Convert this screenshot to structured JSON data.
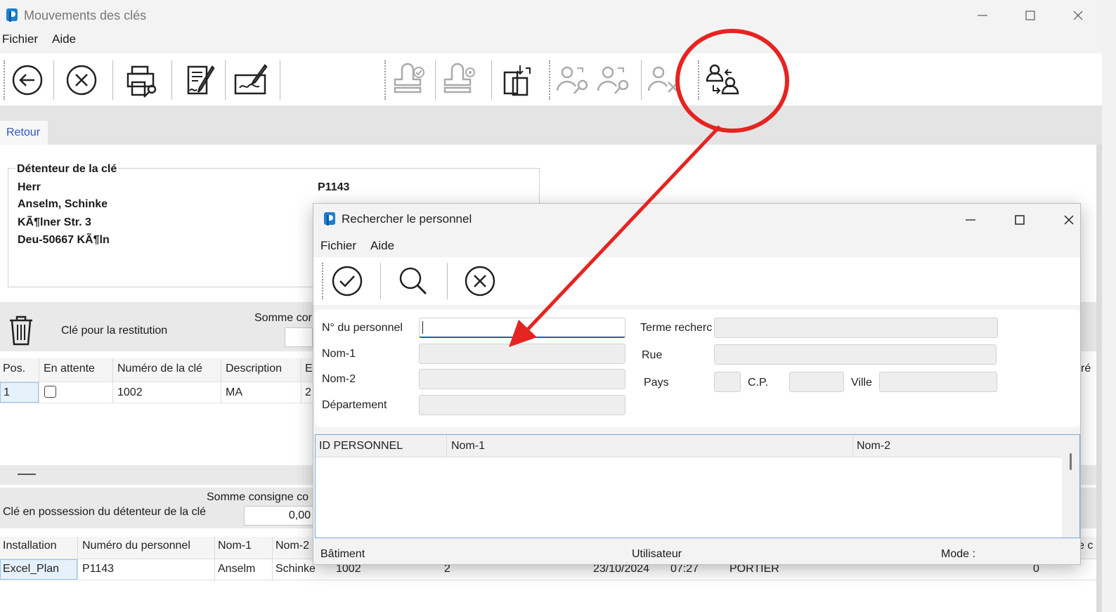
{
  "main": {
    "title": "Mouvements des clés",
    "menu": [
      "Fichier",
      "Aide"
    ],
    "tab_label": "Retour",
    "holder": {
      "legend": "Détenteur de la clé",
      "salutation": "Herr",
      "name": "Anselm, Schinke",
      "street": "KÃ¶lner Str. 3",
      "city": "Deu-50667 KÃ¶ln",
      "personnel_no": "P1143"
    },
    "restitution": {
      "label": "Clé pour la restitution",
      "sum_label": "Somme cor",
      "headers": [
        "Pos.",
        "En attente",
        "Numéro de la clé",
        "Description",
        "E"
      ],
      "row": {
        "pos": "1",
        "key": "1002",
        "desc": "MA",
        "e": "2"
      }
    },
    "possession": {
      "label": "Clé en possession du détenteur de la clé",
      "sum_label": "Somme consigne co",
      "sum_value": "0,00",
      "headers": [
        "Installation",
        "Numéro du personnel",
        "Nom-1",
        "Nom-2"
      ],
      "row": {
        "installation": "Excel_Plan",
        "personnel": "P1143",
        "nom1": "Anselm",
        "nom2": "Schinke",
        "key": "1002",
        "qty": "2",
        "date": "23/10/2024",
        "time": "07:27",
        "user": "PORTIER",
        "zero": "0"
      }
    },
    "right_fragments": {
      "re": "ré",
      "ec": "e c"
    }
  },
  "dialog": {
    "title": "Rechercher le personnel",
    "menu": [
      "Fichier",
      "Aide"
    ],
    "labels": {
      "personnel_no": "N° du personnel",
      "nom1": "Nom-1",
      "nom2": "Nom-2",
      "department": "Département",
      "search_term": "Terme recherc",
      "street": "Rue",
      "country": "Pays",
      "zip": "C.P.",
      "city": "Ville"
    },
    "values": {
      "personnel_no": "",
      "nom1": "",
      "nom2": "",
      "department": "",
      "search_term": "",
      "street": "",
      "country": "",
      "zip": "",
      "city": ""
    },
    "grid_headers": [
      "ID PERSONNEL",
      "Nom-1",
      "Nom-2"
    ],
    "status": {
      "building": "Bâtiment",
      "user": "Utilisateur",
      "mode": "Mode :"
    }
  },
  "colors": {
    "annotation": "#e52421",
    "link": "#2a56c6",
    "focus": "#1f5fb0"
  }
}
